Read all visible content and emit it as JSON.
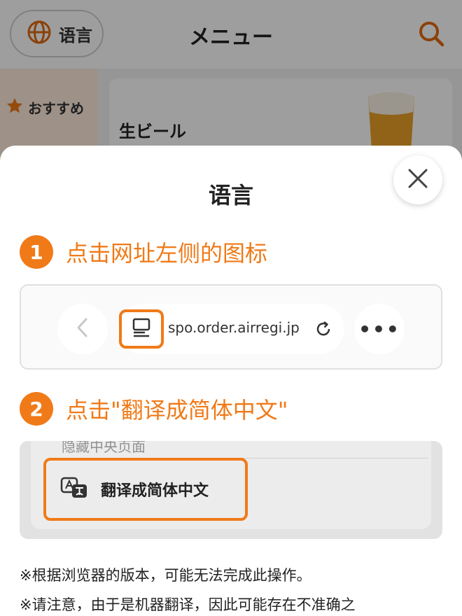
{
  "header": {
    "language_label": "语言",
    "title": "メニュー",
    "icons": {
      "language": "globe-icon",
      "search": "search-icon"
    }
  },
  "sidebar": {
    "items": [
      {
        "label": "おすすめ",
        "icon": "star-icon"
      }
    ]
  },
  "menu_card": {
    "name": "生ビール"
  },
  "sheet": {
    "title": "语言",
    "close_icon": "close-icon",
    "steps": [
      {
        "number": "1",
        "text": "点击网址左侧的图标"
      },
      {
        "number": "2",
        "text": "点击\"翻译成简体中文\""
      }
    ],
    "illustration1": {
      "url": "spo.order.airregi.jp",
      "more": "•••"
    },
    "illustration2": {
      "faded_text": "隐藏中央页面",
      "item_label": "翻译成简体中文"
    },
    "notes": [
      "※根据浏览器的版本，可能无法完成此操作。",
      "※请注意，由于是机器翻译，因此可能存在不准确之"
    ]
  },
  "colors": {
    "accent": "#f07a18",
    "sidebar_bg": "#fdeadb"
  }
}
